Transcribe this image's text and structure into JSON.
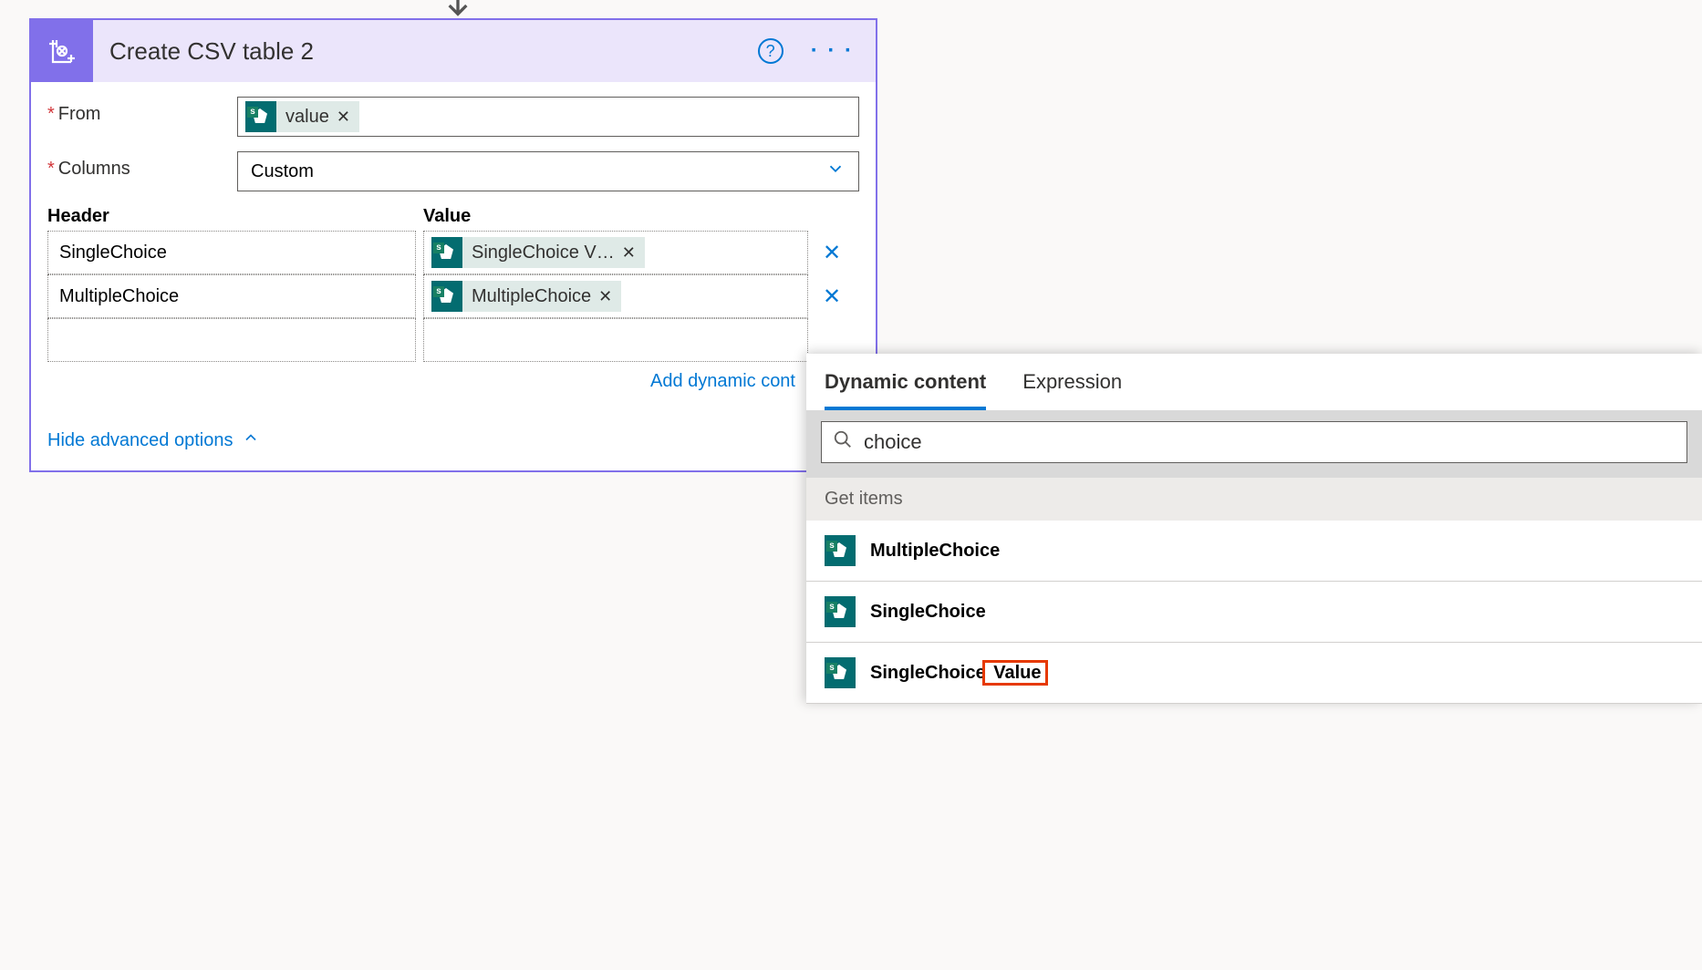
{
  "action": {
    "title": "Create CSV table 2",
    "from_label": "From",
    "columns_label": "Columns",
    "columns_mode": "Custom",
    "from_token": "value",
    "headers_label": "Header",
    "value_label": "Value",
    "rows": [
      {
        "header": "SingleChoice",
        "value_token": "SingleChoice V…"
      },
      {
        "header": "MultipleChoice",
        "value_token": "MultipleChoice"
      }
    ],
    "add_dynamic_text": "Add dynamic cont",
    "hide_advanced": "Hide advanced options"
  },
  "flyout": {
    "tab_dynamic": "Dynamic content",
    "tab_expression": "Expression",
    "search_value": "choice",
    "section": "Get items",
    "items": [
      {
        "label": "MultipleChoice",
        "highlight": null
      },
      {
        "label": "SingleChoice",
        "highlight": null
      },
      {
        "label_prefix": "SingleChoice",
        "label_suffix": " Value",
        "highlight": true
      }
    ]
  }
}
